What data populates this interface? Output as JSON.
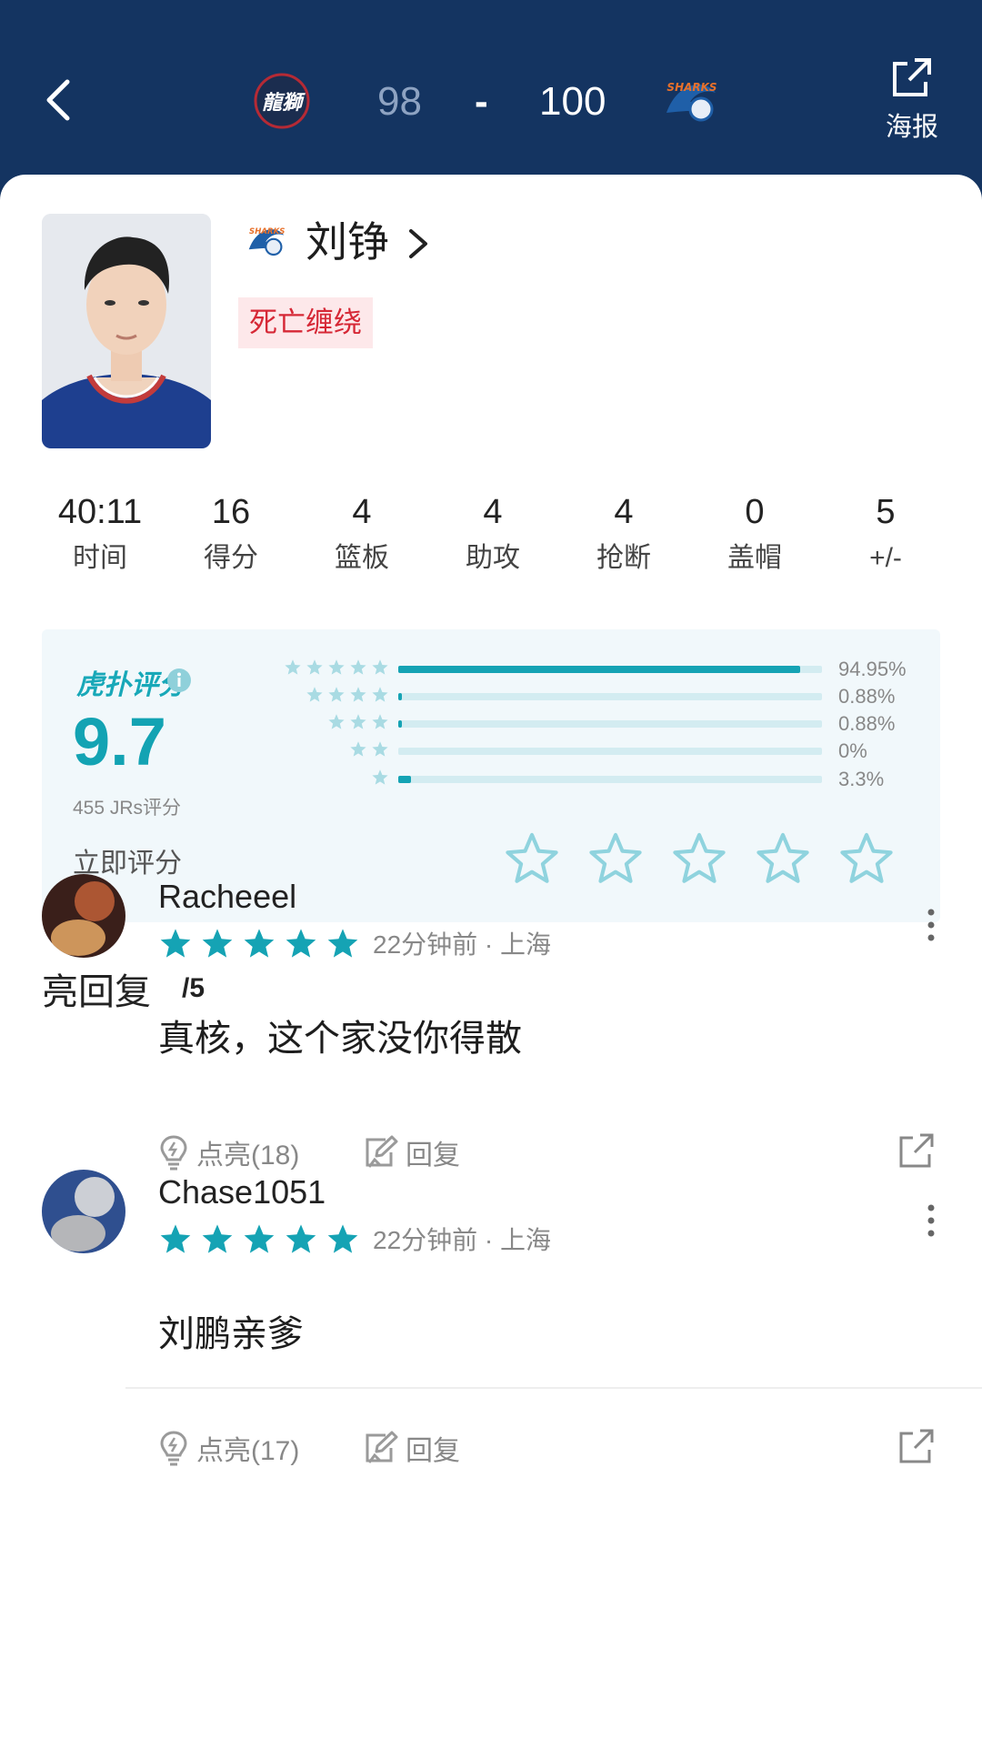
{
  "header": {
    "home_team_logo": "dragon-lions-logo",
    "home_score": "98",
    "separator": "-",
    "away_score": "100",
    "away_team_logo": "sharks-logo",
    "poster_label": "海报"
  },
  "player": {
    "name": "刘铮",
    "tag": "死亡缠绕",
    "team_logo": "sharks-logo"
  },
  "stats": [
    {
      "value": "40:11",
      "label": "时间"
    },
    {
      "value": "16",
      "label": "得分"
    },
    {
      "value": "4",
      "label": "篮板"
    },
    {
      "value": "4",
      "label": "助攻"
    },
    {
      "value": "4",
      "label": "抢断"
    },
    {
      "value": "0",
      "label": "盖帽"
    },
    {
      "value": "5",
      "label": "+/-"
    }
  ],
  "rating": {
    "brand": "虎扑评分",
    "score": "9.7",
    "count": "455 JRs评分",
    "rate_now": "立即评分",
    "distribution": [
      {
        "stars": 5,
        "percent_label": "94.95%",
        "fraction": 0.9495
      },
      {
        "stars": 4,
        "percent_label": "0.88%",
        "fraction": 0.0088
      },
      {
        "stars": 3,
        "percent_label": "0.88%",
        "fraction": 0.0088
      },
      {
        "stars": 2,
        "percent_label": "0%",
        "fraction": 0
      },
      {
        "stars": 1,
        "percent_label": "3.3%",
        "fraction": 0.033
      }
    ],
    "accent_color": "#15a3b4"
  },
  "replies_section": {
    "title": "亮回复",
    "count": "/5"
  },
  "replies": [
    {
      "username": "Racheeel",
      "stars": 5,
      "meta": "22分钟前 · 上海",
      "content": "真核，这个家没你得散",
      "like_label": "点亮(18)",
      "reply_label": "回复"
    },
    {
      "username": "Chase1051",
      "stars": 5,
      "meta": "22分钟前 · 上海",
      "content": "刘鹏亲爹",
      "like_label": "点亮(17)",
      "reply_label": "回复"
    }
  ]
}
